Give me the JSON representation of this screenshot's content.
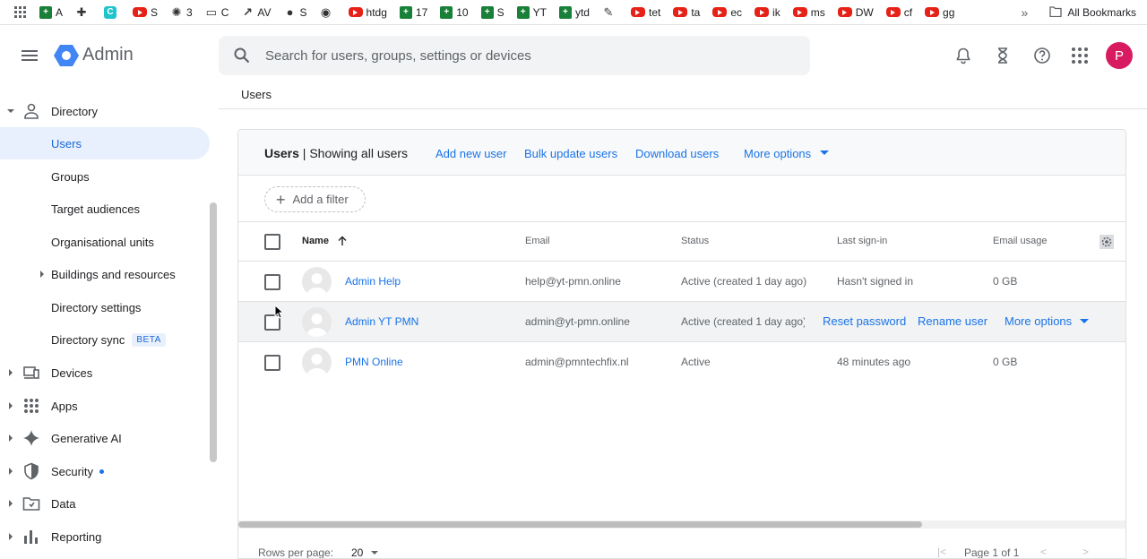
{
  "bookmarks": [
    {
      "label": "A",
      "icon": "sheets-icon"
    },
    {
      "label": "",
      "icon": "puzzle-icon"
    },
    {
      "label": "",
      "icon": "canva-icon"
    },
    {
      "label": "S",
      "icon": "youtube-icon"
    },
    {
      "label": "3",
      "icon": "openai-icon"
    },
    {
      "label": "C",
      "icon": "folder-icon"
    },
    {
      "label": "AV",
      "icon": "trend-icon"
    },
    {
      "label": "S",
      "icon": "globe-icon"
    },
    {
      "label": "",
      "icon": "github-icon"
    },
    {
      "label": "htdg",
      "icon": "youtube-icon"
    },
    {
      "label": "17",
      "icon": "sheets-icon"
    },
    {
      "label": "10",
      "icon": "sheets-icon"
    },
    {
      "label": "S",
      "icon": "sheets-icon"
    },
    {
      "label": "YT",
      "icon": "sheets-icon"
    },
    {
      "label": "ytd",
      "icon": "sheets-icon"
    },
    {
      "label": "",
      "icon": "pin-icon"
    },
    {
      "label": "tet",
      "icon": "youtube-icon"
    },
    {
      "label": "ta",
      "icon": "youtube-icon"
    },
    {
      "label": "ec",
      "icon": "youtube-icon"
    },
    {
      "label": "ik",
      "icon": "youtube-icon"
    },
    {
      "label": "ms",
      "icon": "youtube-icon"
    },
    {
      "label": "DW",
      "icon": "youtube-icon"
    },
    {
      "label": "cf",
      "icon": "youtube-icon"
    },
    {
      "label": "gg",
      "icon": "youtube-icon"
    }
  ],
  "bookmarks_more": "»",
  "all_bookmarks": "All Bookmarks",
  "header": {
    "app_name": "Admin",
    "search_placeholder": "Search for users, groups, settings or devices",
    "avatar_letter": "P"
  },
  "breadcrumb": "Users",
  "sidebar": {
    "directory": "Directory",
    "items": [
      "Users",
      "Groups",
      "Target audiences",
      "Organisational units",
      "Buildings and resources",
      "Directory settings",
      "Directory sync"
    ],
    "beta": "BETA",
    "sections": [
      "Devices",
      "Apps",
      "Generative AI",
      "Security",
      "Data",
      "Reporting"
    ]
  },
  "card": {
    "title_bold": "Users",
    "title_rest": " | Showing all users",
    "actions": [
      "Add new user",
      "Bulk update users",
      "Download users",
      "More options"
    ],
    "add_filter": "Add a filter",
    "columns": [
      "Name",
      "Email",
      "Status",
      "Last sign-in",
      "Email usage"
    ],
    "rows": [
      {
        "name": "Admin Help",
        "email": "help@yt-pmn.online",
        "status": "Active (created 1 day ago)",
        "last_signin": "Hasn't signed in",
        "usage": "0 GB"
      },
      {
        "name": "Admin YT PMN",
        "email": "admin@yt-pmn.online",
        "status": "Active (created 1 day ago)",
        "last_signin": "",
        "usage": ""
      },
      {
        "name": "PMN Online",
        "email": "admin@pmntechfix.nl",
        "status": "Active",
        "last_signin": "48 minutes ago",
        "usage": "0 GB"
      }
    ],
    "row_actions": [
      "Reset password",
      "Rename user",
      "More options"
    ],
    "footer_rows_label": "Rows per page:",
    "footer_rows_value": "20",
    "footer_page": "Page 1 of 1"
  },
  "colors": {
    "accent": "#1a73e8",
    "avatar": "#d81b60"
  }
}
